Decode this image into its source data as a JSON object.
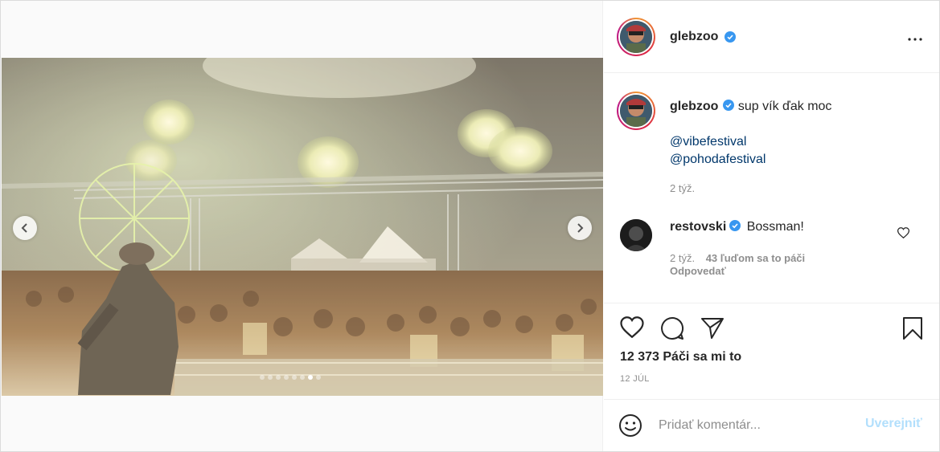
{
  "post": {
    "username": "glebzoo",
    "verified": true,
    "more_icon": "more-horizontal-icon",
    "carousel": {
      "image_description_icon": "concert-stage-photo",
      "slide_count": 8,
      "active_slide": 7
    },
    "caption": {
      "username": "glebzoo",
      "text": "sup vík ďak moc",
      "mentions": [
        "@vibefestival",
        "@pohodafestival"
      ],
      "time": "2 týž."
    },
    "comments": [
      {
        "username": "restovski",
        "verified": true,
        "text": "Bossman!",
        "time": "2 týž.",
        "likes": "43 ľuďom sa to páči",
        "reply": "Odpovedať"
      }
    ],
    "likes_text": "12 373 Páči sa mi to",
    "date": "12 JÚL",
    "add_comment": {
      "placeholder": "Pridať komentár...",
      "publish_label": "Uverejniť"
    }
  },
  "colors": {
    "verified": "#3897f0",
    "link": "#00376b",
    "muted": "#8e8e8e",
    "publish_disabled": "#b2dffc"
  }
}
